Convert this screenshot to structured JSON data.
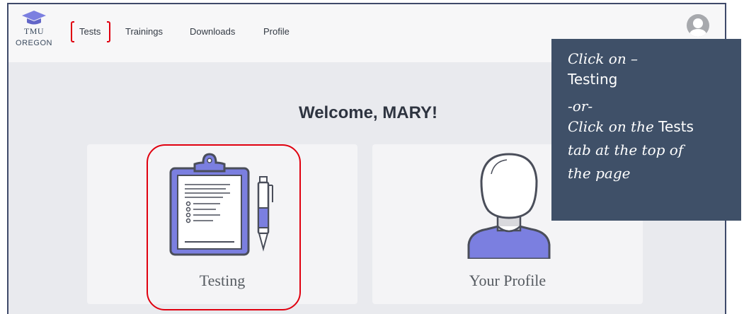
{
  "logo": {
    "line1": "TMU",
    "line2": "OREGON"
  },
  "nav": {
    "tests": "Tests",
    "trainings": "Trainings",
    "downloads": "Downloads",
    "profile": "Profile"
  },
  "header": {
    "avatar_icon": "user-avatar-icon"
  },
  "main": {
    "welcome": "Welcome, MARY!",
    "cards": [
      {
        "label": "Testing",
        "icon": "clipboard-pen-icon"
      },
      {
        "label": "Your Profile",
        "icon": "person-icon"
      }
    ]
  },
  "callout": {
    "line1": "Click on –",
    "line2": "Testing",
    "line3": "-or-",
    "line4a": "Click on the ",
    "line4b": "Tests",
    "line5": "tab at the top of",
    "line6": "the page"
  },
  "colors": {
    "accent": "#7b7fe0",
    "callout_bg": "#3f5068",
    "highlight": "#e0000f",
    "frame_border": "#3f4a6a"
  }
}
